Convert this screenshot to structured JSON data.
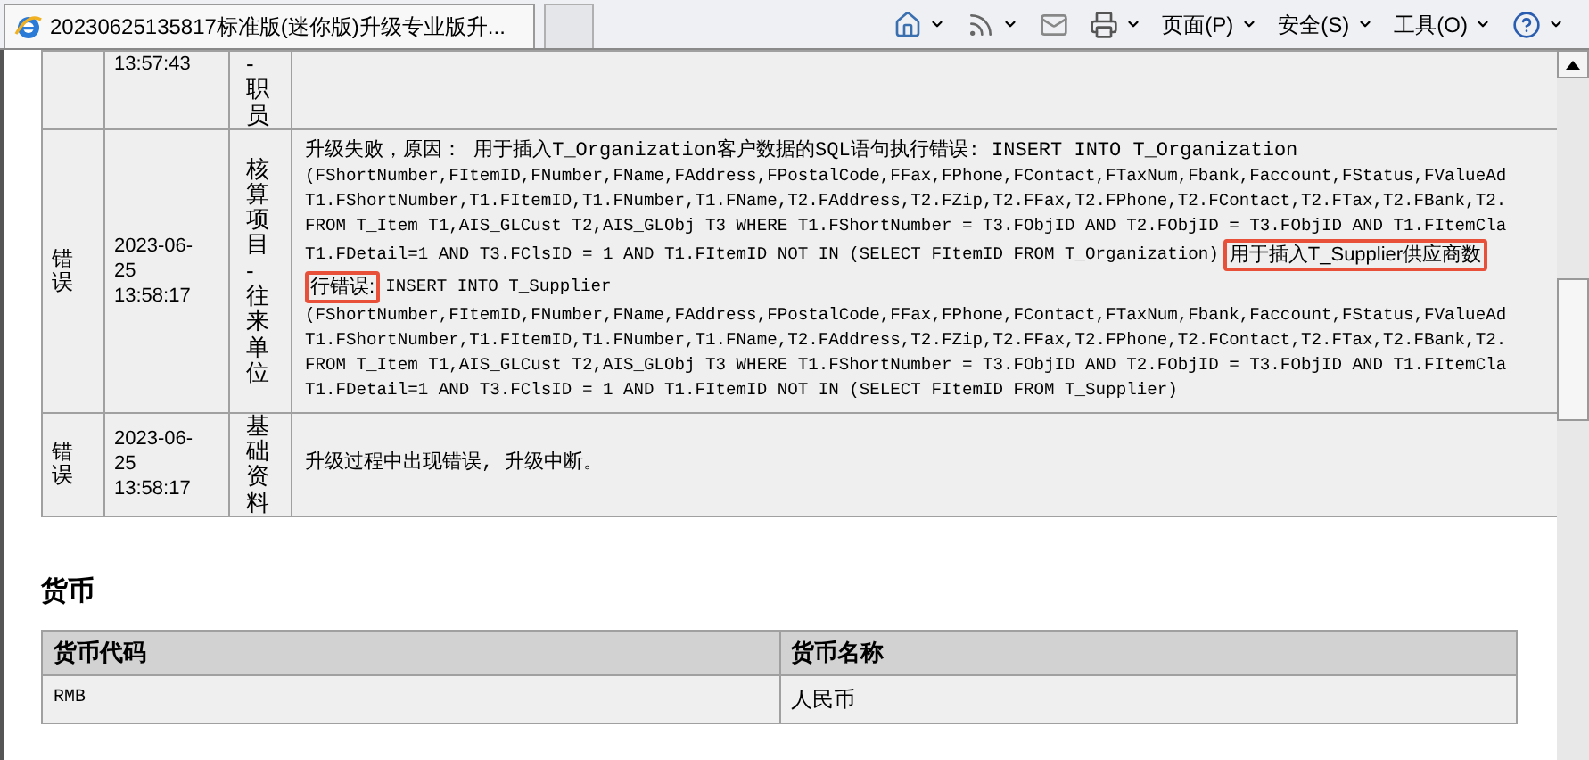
{
  "browser": {
    "tab_title": "20230625135817标准版(迷你版)升级专业版升...",
    "toolbar": [
      {
        "kind": "home"
      },
      {
        "kind": "feeds"
      },
      {
        "kind": "mail"
      },
      {
        "kind": "print"
      },
      {
        "kind": "menu",
        "label": "页面(P)"
      },
      {
        "kind": "menu",
        "label": "安全(S)"
      },
      {
        "kind": "menu",
        "label": "工具(O)"
      },
      {
        "kind": "help"
      }
    ]
  },
  "log_table": {
    "rows": [
      {
        "level": "",
        "time": [
          "13:57:43"
        ],
        "category": "-职员",
        "message": []
      },
      {
        "level": "错误",
        "time": [
          "2023-06-",
          "25",
          "13:58:17"
        ],
        "category": "核算项目-往来单位",
        "message": [
          [
            {
              "text": "升级失败，原因： 用于插入T_Organization客户数据的SQL语句执行错误: INSERT INTO T_Organization",
              "highlighted": false
            }
          ],
          [
            {
              "text": "(FShortNumber,FItemID,FNumber,FName,FAddress,FPostalCode,FFax,FPhone,FContact,FTaxNum,Fbank,Faccount,FStatus,FValueAd",
              "highlighted": false
            }
          ],
          [
            {
              "text": "T1.FShortNumber,T1.FItemID,T1.FNumber,T1.FName,T2.FAddress,T2.FZip,T2.FFax,T2.FPhone,T2.FContact,T2.FTax,T2.FBank,T2.",
              "highlighted": false
            }
          ],
          [
            {
              "text": "FROM T_Item T1,AIS_GLCust T2,AIS_GLObj T3 WHERE T1.FShortNumber = T3.FObjID AND T2.FObjID = T3.FObjID AND T1.FItemCla",
              "highlighted": false
            }
          ],
          [
            {
              "text": "T1.FDetail=1 AND T3.FClsID = 1 AND T1.FItemID NOT IN (SELECT FItemID FROM T_Organization)",
              "highlighted": false
            },
            {
              "text": "用于插入T_Supplier供应商数",
              "highlighted": true
            }
          ],
          [
            {
              "text": "行错误:",
              "highlighted": true
            },
            {
              "text": "INSERT INTO T_Supplier",
              "highlighted": false
            }
          ],
          [
            {
              "text": "(FShortNumber,FItemID,FNumber,FName,FAddress,FPostalCode,FFax,FPhone,FContact,FTaxNum,Fbank,Faccount,FStatus,FValueAd",
              "highlighted": false
            }
          ],
          [
            {
              "text": "T1.FShortNumber,T1.FItemID,T1.FNumber,T1.FName,T2.FAddress,T2.FZip,T2.FFax,T2.FPhone,T2.FContact,T2.FTax,T2.FBank,T2.",
              "highlighted": false
            }
          ],
          [
            {
              "text": "FROM T_Item T1,AIS_GLCust T2,AIS_GLObj T3 WHERE T1.FShortNumber = T3.FObjID AND T2.FObjID = T3.FObjID AND T1.FItemCla",
              "highlighted": false
            }
          ],
          [
            {
              "text": "T1.FDetail=1 AND T3.FClsID = 1 AND T1.FItemID NOT IN (SELECT FItemID FROM T_Supplier)",
              "highlighted": false
            }
          ]
        ]
      },
      {
        "level": "错误",
        "time": [
          "2023-06-",
          "25",
          "13:58:17"
        ],
        "category": "基础资料",
        "message": [
          [
            {
              "text": "升级过程中出现错误, 升级中断。",
              "highlighted": false
            }
          ]
        ]
      }
    ]
  },
  "currency": {
    "title": "货币",
    "columns": [
      "货币代码",
      "货币名称"
    ],
    "rows": [
      [
        "RMB",
        "人民币"
      ]
    ]
  }
}
